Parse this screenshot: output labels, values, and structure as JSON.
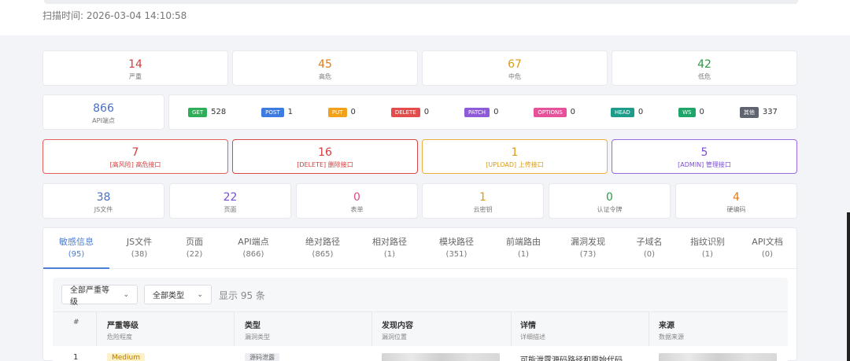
{
  "scan_time": "扫描时间: 2026-03-04 14:10:58",
  "severity": [
    {
      "value": "14",
      "label": "严重",
      "color": "#d83b3b"
    },
    {
      "value": "45",
      "label": "高危",
      "color": "#e07b19"
    },
    {
      "value": "67",
      "label": "中危",
      "color": "#d99a16"
    },
    {
      "value": "42",
      "label": "低危",
      "color": "#2e9a48"
    }
  ],
  "api": {
    "total": "866",
    "label": "API端点"
  },
  "methods": [
    {
      "tag": "GET",
      "count": "528",
      "color": "#2fae5a"
    },
    {
      "tag": "POST",
      "count": "1",
      "color": "#3e7be0"
    },
    {
      "tag": "PUT",
      "count": "0",
      "color": "#f2a11a"
    },
    {
      "tag": "DELETE",
      "count": "0",
      "color": "#e44b4b"
    },
    {
      "tag": "PATCH",
      "count": "0",
      "color": "#8e5ad8"
    },
    {
      "tag": "OPTIONS",
      "count": "0",
      "color": "#e6519a"
    },
    {
      "tag": "HEAD",
      "count": "0",
      "color": "#1e9c8a"
    },
    {
      "tag": "WS",
      "count": "0",
      "color": "#1fa46a"
    },
    {
      "tag": "其他",
      "count": "337",
      "color": "#5f6470"
    }
  ],
  "risk_cards": [
    {
      "value": "7",
      "label": "[高风险] 高危接口",
      "color": "#d83b3b"
    },
    {
      "value": "16",
      "label": "[DELETE] 删除接口",
      "color": "#d83b3b"
    },
    {
      "value": "1",
      "label": "[UPLOAD] 上传接口",
      "color": "#e09a16"
    },
    {
      "value": "5",
      "label": "[ADMIN] 管理接口",
      "color": "#8a5ad8"
    }
  ],
  "stats": [
    {
      "value": "38",
      "label": "JS文件",
      "color": "#4a6fc4"
    },
    {
      "value": "22",
      "label": "页面",
      "color": "#7a4fd0"
    },
    {
      "value": "0",
      "label": "表单",
      "color": "#e44b8a"
    },
    {
      "value": "1",
      "label": "云密钥",
      "color": "#e09a16"
    },
    {
      "value": "0",
      "label": "认证令牌",
      "color": "#2e9a48"
    },
    {
      "value": "4",
      "label": "硬编码",
      "color": "#e07b19"
    }
  ],
  "tabs": [
    {
      "label": "敏感信息",
      "count": "(95)"
    },
    {
      "label": "JS文件",
      "count": "(38)"
    },
    {
      "label": "页面",
      "count": "(22)"
    },
    {
      "label": "API端点",
      "count": "(866)"
    },
    {
      "label": "绝对路径",
      "count": "(865)"
    },
    {
      "label": "相对路径",
      "count": "(1)"
    },
    {
      "label": "模块路径",
      "count": "(351)"
    },
    {
      "label": "前端路由",
      "count": "(1)"
    },
    {
      "label": "漏洞发现",
      "count": "(73)"
    },
    {
      "label": "子域名",
      "count": "(0)"
    },
    {
      "label": "指纹识别",
      "count": "(1)"
    },
    {
      "label": "API文档",
      "count": "(0)"
    }
  ],
  "filters": {
    "severity_select": "全部严重等级",
    "type_select": "全部类型",
    "count_text": "显示 95 条"
  },
  "table": {
    "headers": [
      {
        "title": "#",
        "sub": ""
      },
      {
        "title": "严重等级",
        "sub": "危险程度"
      },
      {
        "title": "类型",
        "sub": "漏洞类型"
      },
      {
        "title": "发现内容",
        "sub": "漏洞位置"
      },
      {
        "title": "详情",
        "sub": "详细描述"
      },
      {
        "title": "来源",
        "sub": "数据来源"
      }
    ],
    "rows": [
      {
        "index": "1",
        "severity": "Medium",
        "type": "源码泄露",
        "detail": "可能泄露源码路径和原始代码"
      }
    ]
  }
}
